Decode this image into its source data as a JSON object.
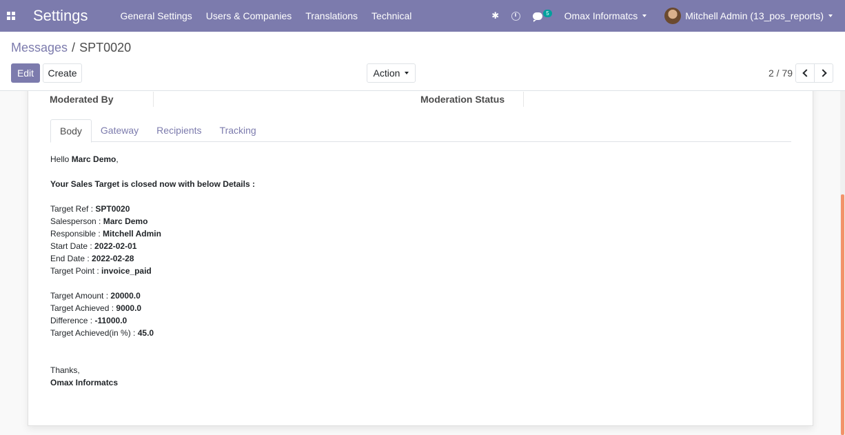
{
  "navbar": {
    "app_name": "Settings",
    "menu": [
      "General Settings",
      "Users & Companies",
      "Translations",
      "Technical"
    ],
    "bug_glyph": "✱",
    "chat_count": "5",
    "company": "Omax Informatcs",
    "user": "Mitchell Admin (13_pos_reports)",
    "accent": "#7c7bad"
  },
  "breadcrumb": {
    "parent": "Messages",
    "separator": "/",
    "current": "SPT0020"
  },
  "toolbar": {
    "edit": "Edit",
    "create": "Create",
    "action": "Action"
  },
  "pager": {
    "value": "2 / 79"
  },
  "form": {
    "moderated_by_label": "Moderated By",
    "moderation_status_label": "Moderation Status",
    "tabs": [
      "Body",
      "Gateway",
      "Recipients",
      "Tracking"
    ],
    "active_tab": "Body"
  },
  "body": {
    "greeting": "Hello ",
    "customer": "Marc Demo",
    "greeting_end": ",",
    "intro": "Your Sales Target is closed now with below Details :",
    "details": [
      {
        "label": "Target Ref : ",
        "value": "SPT0020"
      },
      {
        "label": "Salesperson : ",
        "value": "Marc Demo"
      },
      {
        "label": "Responsible : ",
        "value": "Mitchell Admin"
      },
      {
        "label": "Start Date : ",
        "value": "2022-02-01"
      },
      {
        "label": "End Date : ",
        "value": "2022-02-28"
      },
      {
        "label": "Target Point : ",
        "value": "invoice_paid"
      }
    ],
    "amounts": [
      {
        "label": "Target Amount : ",
        "value": "20000.0"
      },
      {
        "label": "Target Achieved : ",
        "value": "9000.0"
      },
      {
        "label": "Difference : ",
        "value": "-11000.0"
      },
      {
        "label": "Target Achieved(in %) : ",
        "value": "45.0"
      }
    ],
    "thanks": "Thanks,",
    "signature": "Omax Informatcs"
  }
}
